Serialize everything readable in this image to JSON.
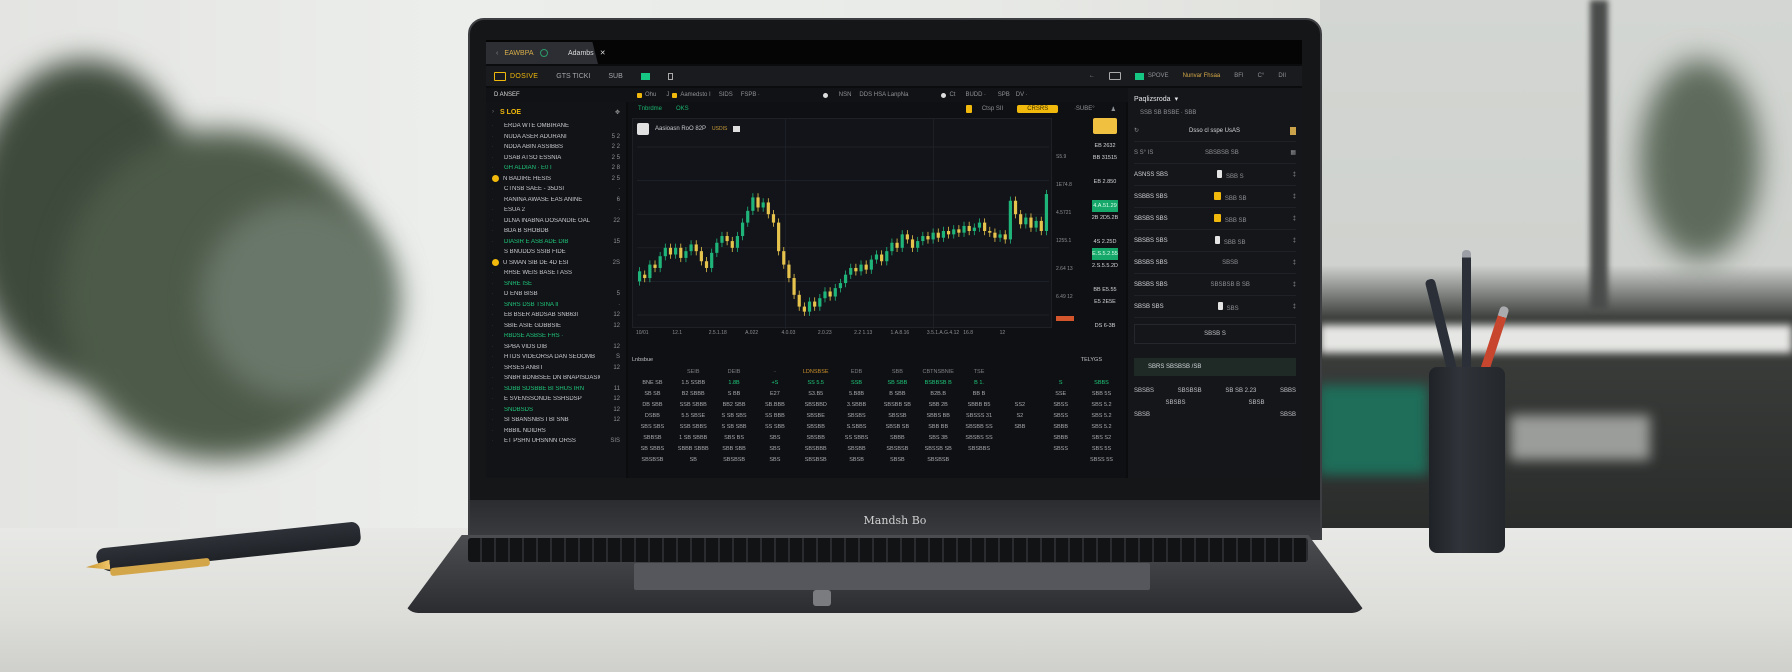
{
  "scene": {
    "laptop_brand": "Mandsh Bo"
  },
  "browser": {
    "tabs": [
      {
        "label": "EAWBPA",
        "active": true
      },
      {
        "label": "Adambs",
        "active": false
      }
    ]
  },
  "app": {
    "brand": "DOSIVE",
    "nav": [
      "GTS TICKI",
      "SUB"
    ],
    "top_right": {
      "status": "SPOVE",
      "account": "Nunvar Fhsaa",
      "items": [
        "BFI",
        "C°",
        "DII"
      ]
    },
    "subbar": {
      "left_label": "D ANSEF",
      "items": [
        "Ohu",
        "J",
        "Aamedsto I",
        "SIDS",
        "FSPB ∙",
        "NSN",
        "DDS HSA LanpNa",
        "Ct",
        "BUDD ∙",
        "SPB",
        "DV ∙"
      ]
    }
  },
  "watchlist": {
    "title": "S LOE",
    "rows": [
      {
        "name": "ERDA WTE OMBIRANE",
        "value": "",
        "coin": false,
        "green": false
      },
      {
        "name": "NUDA ASER ADURANI",
        "value": "5 2",
        "coin": false,
        "green": false
      },
      {
        "name": "NDDA ABIN ASSIBBS",
        "value": "2 2",
        "coin": false,
        "green": false
      },
      {
        "name": "DSAB ATSO ESSNIA",
        "value": "2 5",
        "coin": false,
        "green": false
      },
      {
        "name": "GH ALDIAN ∙ E0 I",
        "value": "2 8",
        "coin": false,
        "green": true
      },
      {
        "name": "N BADIRE HESIS",
        "value": "2 5",
        "coin": true,
        "green": false
      },
      {
        "name": "CTNSB SAEE - 35DSI",
        "value": "∙",
        "coin": false,
        "green": false
      },
      {
        "name": "RANINA AWASE EAS ANINE",
        "value": "6",
        "coin": false,
        "green": false
      },
      {
        "name": "ESUA 2",
        "value": "∙",
        "coin": false,
        "green": false
      },
      {
        "name": "DLNA INABNA DOSANDIE OAL",
        "value": "22",
        "coin": false,
        "green": false
      },
      {
        "name": "BDA B SHOBDB",
        "value": "",
        "coin": false,
        "green": false
      },
      {
        "name": "DIASIR E ASB ADE DIB",
        "value": "15",
        "coin": false,
        "green": true
      },
      {
        "name": "S BNUDDS SSIB FIDE",
        "value": "",
        "coin": false,
        "green": false
      },
      {
        "name": "U SMAN SIB DE 4D ESI",
        "value": "2S",
        "coin": true,
        "green": false
      },
      {
        "name": "RHSE WEIS BASE I ASS",
        "value": "",
        "coin": false,
        "green": false
      },
      {
        "name": "SNRE ISE",
        "value": "",
        "coin": false,
        "green": true
      },
      {
        "name": "D ENB BISB",
        "value": "5",
        "coin": false,
        "green": false
      },
      {
        "name": "SNRS DSB TSINA II",
        "value": "∙",
        "coin": false,
        "green": true
      },
      {
        "name": "EB BSER ABDSAB SNB63I",
        "value": "12",
        "coin": false,
        "green": false
      },
      {
        "name": "SBIE ASIE GDBBSIE",
        "value": "12",
        "coin": false,
        "green": false
      },
      {
        "name": "RBDSE ASBSE FRS ∙",
        "value": "",
        "coin": false,
        "green": true
      },
      {
        "name": "SPBA VIDS DIB",
        "value": "12",
        "coin": false,
        "green": false
      },
      {
        "name": "HTDS VIDEORSA DAN SEOOMB",
        "value": "S",
        "coin": false,
        "green": false
      },
      {
        "name": "SRSES ANBIT",
        "value": "12",
        "coin": false,
        "green": false
      },
      {
        "name": "SNBR BDNBSEE DN BNAPISDASIO",
        "value": "",
        "coin": false,
        "green": false
      },
      {
        "name": "SDBB SDSBBE BI SHUS IRN",
        "value": "11",
        "coin": false,
        "green": true
      },
      {
        "name": "E SVENSSONDE SSHSDSP",
        "value": "12",
        "coin": false,
        "green": false
      },
      {
        "name": "SNDBSDS",
        "value": "12",
        "coin": false,
        "green": true
      },
      {
        "name": "SI SBANSNBS I BI SNB",
        "value": "12",
        "coin": false,
        "green": false
      },
      {
        "name": "RBBIL NDIDRS",
        "value": "",
        "coin": false,
        "green": false
      },
      {
        "name": "ET PSHN UHSNNN ORSS",
        "value": "SIS",
        "coin": false,
        "green": false
      }
    ]
  },
  "chart_header": {
    "left_tags": [
      "Tnbrdme",
      "OKS"
    ],
    "center_label": "Ctsp SII",
    "button": "CRSRS",
    "right_label": "∙SUBE°"
  },
  "chart_data": {
    "type": "candlestick",
    "title": "Aasioasn RoO 82P",
    "subtitle": "USDIS",
    "series": [
      {
        "name": "price",
        "values": [
          [
            0.2,
            0.26
          ],
          [
            0.24,
            0.22
          ],
          [
            0.22,
            0.3
          ],
          [
            0.3,
            0.28
          ],
          [
            0.28,
            0.35
          ],
          [
            0.35,
            0.4
          ],
          [
            0.4,
            0.36
          ],
          [
            0.36,
            0.4
          ],
          [
            0.4,
            0.34
          ],
          [
            0.34,
            0.38
          ],
          [
            0.38,
            0.42
          ],
          [
            0.42,
            0.38
          ],
          [
            0.38,
            0.32
          ],
          [
            0.32,
            0.28
          ],
          [
            0.28,
            0.37
          ],
          [
            0.37,
            0.43
          ],
          [
            0.43,
            0.47
          ],
          [
            0.47,
            0.44
          ],
          [
            0.44,
            0.4
          ],
          [
            0.4,
            0.47
          ],
          [
            0.47,
            0.55
          ],
          [
            0.55,
            0.62
          ],
          [
            0.62,
            0.7
          ],
          [
            0.7,
            0.64
          ],
          [
            0.64,
            0.67
          ],
          [
            0.67,
            0.6
          ],
          [
            0.6,
            0.55
          ],
          [
            0.55,
            0.38
          ],
          [
            0.38,
            0.3
          ],
          [
            0.3,
            0.22
          ],
          [
            0.22,
            0.12
          ],
          [
            0.12,
            0.05
          ],
          [
            0.05,
            0.02
          ],
          [
            0.02,
            0.08
          ],
          [
            0.08,
            0.05
          ],
          [
            0.05,
            0.1
          ],
          [
            0.1,
            0.14
          ],
          [
            0.14,
            0.11
          ],
          [
            0.11,
            0.16
          ],
          [
            0.16,
            0.19
          ],
          [
            0.19,
            0.24
          ],
          [
            0.24,
            0.28
          ],
          [
            0.28,
            0.26
          ],
          [
            0.26,
            0.3
          ],
          [
            0.3,
            0.27
          ],
          [
            0.27,
            0.33
          ],
          [
            0.33,
            0.36
          ],
          [
            0.36,
            0.32
          ],
          [
            0.32,
            0.38
          ],
          [
            0.38,
            0.43
          ],
          [
            0.43,
            0.4
          ],
          [
            0.4,
            0.48
          ],
          [
            0.48,
            0.45
          ],
          [
            0.45,
            0.4
          ],
          [
            0.4,
            0.44
          ],
          [
            0.44,
            0.47
          ],
          [
            0.47,
            0.45
          ],
          [
            0.45,
            0.49
          ],
          [
            0.49,
            0.46
          ],
          [
            0.46,
            0.5
          ],
          [
            0.5,
            0.48
          ],
          [
            0.48,
            0.51
          ],
          [
            0.51,
            0.49
          ],
          [
            0.49,
            0.53
          ],
          [
            0.53,
            0.5
          ],
          [
            0.5,
            0.52
          ],
          [
            0.52,
            0.55
          ],
          [
            0.55,
            0.5
          ],
          [
            0.5,
            0.49
          ],
          [
            0.49,
            0.46
          ],
          [
            0.46,
            0.48
          ],
          [
            0.48,
            0.45
          ],
          [
            0.45,
            0.68
          ],
          [
            0.68,
            0.6
          ],
          [
            0.6,
            0.54
          ],
          [
            0.54,
            0.58
          ],
          [
            0.58,
            0.52
          ],
          [
            0.52,
            0.56
          ],
          [
            0.56,
            0.5
          ],
          [
            0.5,
            0.72
          ]
        ]
      }
    ],
    "y_ticks": [
      "S5.9",
      "1E74.8",
      "4.5721",
      "1255.1",
      "2.64 13",
      "6.49 12"
    ],
    "x_ticks": [
      "10/01",
      "12.1",
      "2.5.1.18",
      "A.022",
      "4.0.03",
      "2.0.23",
      "2.2 1.13",
      "1.A.8.16",
      "3.5.1.A.G.4.12",
      "16.8",
      "12"
    ],
    "last_price_tag": "12",
    "ylim": [
      0,
      1
    ]
  },
  "order_book": {
    "button": "O",
    "rows": [
      {
        "text": "EB 2632",
        "green": false
      },
      {
        "text": "BB 31515",
        "green": false
      },
      {
        "text": "",
        "green": false
      },
      {
        "text": "EB 2.850",
        "green": false
      },
      {
        "text": "",
        "green": false
      },
      {
        "text": "4.A.51.29",
        "green": true
      },
      {
        "text": "2B 2D5.2B",
        "green": false
      },
      {
        "text": "",
        "green": false
      },
      {
        "text": "4S 2.25D",
        "green": false
      },
      {
        "text": "E.S.5.2.55",
        "green": true
      },
      {
        "text": "2.S.5.5.2D",
        "green": false
      },
      {
        "text": "",
        "green": false
      },
      {
        "text": "BB E5.55",
        "green": false
      },
      {
        "text": "E5 2E5E",
        "green": false
      },
      {
        "text": "",
        "green": false
      },
      {
        "text": "DS 6-3B",
        "green": false
      }
    ]
  },
  "trades_table": {
    "title": "Lnbsbue",
    "right_label": "TELYGS",
    "headers": [
      "",
      "SEIB",
      "DEIB",
      "∙∙",
      "LDNSBSE",
      "EDB",
      "SBB",
      "CBTNSBNIE",
      "TSE",
      "",
      "",
      ""
    ],
    "rows": [
      [
        "BNE SB",
        "1.5 SSBB",
        "1.8B",
        "+S",
        "SS 5.5",
        "SSB",
        "SB SBB",
        "BSBBSB B",
        "B 1.",
        "",
        "S",
        "SBBS"
      ],
      [
        "SB SB",
        "B2 SBBB",
        "S BB",
        "E27",
        "S3.B5",
        "5.B8B",
        "B SBB",
        "B2B.B",
        "BB B",
        "",
        "SSE",
        "SBB 5S"
      ],
      [
        "DB SBB",
        "SSB SBBB",
        "BB2 SBB",
        "SB.BBB",
        "SBSBBD",
        "3.SBBB",
        "SBSBB SB",
        "SBB 2B",
        "SBBB B5",
        "SS2",
        "SBSS",
        "SBS 5.2"
      ],
      [
        "DSBB",
        "5.5 SBSE",
        "S SB SBS",
        "SS BBB",
        "SBSBE",
        "SBSBS",
        "SBSSB",
        "SBBS BB",
        "SBSSS 31",
        "S2",
        "SBSS",
        "SBS 5.2"
      ],
      [
        "SBS SBS",
        "SSB SBBS",
        "S SB SBB",
        "SS SBB",
        "SBSBB",
        "S.SBBS",
        "SBSB SB",
        "SBB BB",
        "SBSBB SS",
        "SBB",
        "SBBB",
        "SBS 5.2"
      ],
      [
        "SBBSB",
        "1 SB SBBB",
        "SBS BS",
        "SBS",
        "SBSBB",
        "SS SBBS",
        "SBBB",
        "SBS 3B",
        "SBSBS SS",
        "",
        "SBBB",
        "SBS S2"
      ],
      [
        "SB SBBS",
        "SBBB SBBB",
        "SBB SBB",
        "SBS",
        "SBSBBB",
        "SBSBB",
        "SBSBSB",
        "SBSSB SB",
        "SBSBBS",
        "",
        "SBSS",
        "SBS 5S"
      ],
      [
        "SBSBSB",
        "SB",
        "SBSBSB",
        "SBS",
        "SBSBSB",
        "SBSB",
        "SBSB",
        "SBSBSB",
        "",
        "",
        "",
        "SBSS 5S"
      ]
    ]
  },
  "right_panel": {
    "title": "Paqlizsroda",
    "subtitle": "SSB SB BSBE ∙ SBB",
    "header_row": {
      "label": "Dsso cl sspe UsAS"
    },
    "filter_row": {
      "left": "S S° IS",
      "center": "SBSBSB SB"
    },
    "rows": [
      {
        "name": "ASNSS SBS",
        "value": "SBB S",
        "icon": "white"
      },
      {
        "name": "SSBBS SBS",
        "value": "SBB SB",
        "icon": "yellow"
      },
      {
        "name": "SBSBS SBS",
        "value": "SBB SB",
        "icon": "yellow"
      },
      {
        "name": "SBSBS SBS",
        "value": "SBB SB",
        "icon": "white"
      },
      {
        "name": "SBSBS SBS",
        "value": "SBSB",
        "icon": "none"
      },
      {
        "name": "SBSBS SBS",
        "value": "SBSBSB B SB",
        "icon": "none"
      },
      {
        "name": "SBSB SBS",
        "value": "SBS",
        "icon": "white"
      }
    ],
    "input_label": "SBSB S",
    "green_bar": "SBRS SBSBSB /SB",
    "footer": [
      "SBSBS",
      "SBSBSB",
      "SB SB 2.23",
      "SBBS"
    ],
    "footer2": [
      "SBSBS",
      "SBSB"
    ],
    "footer3": [
      "SBSB",
      "SBSB"
    ]
  }
}
